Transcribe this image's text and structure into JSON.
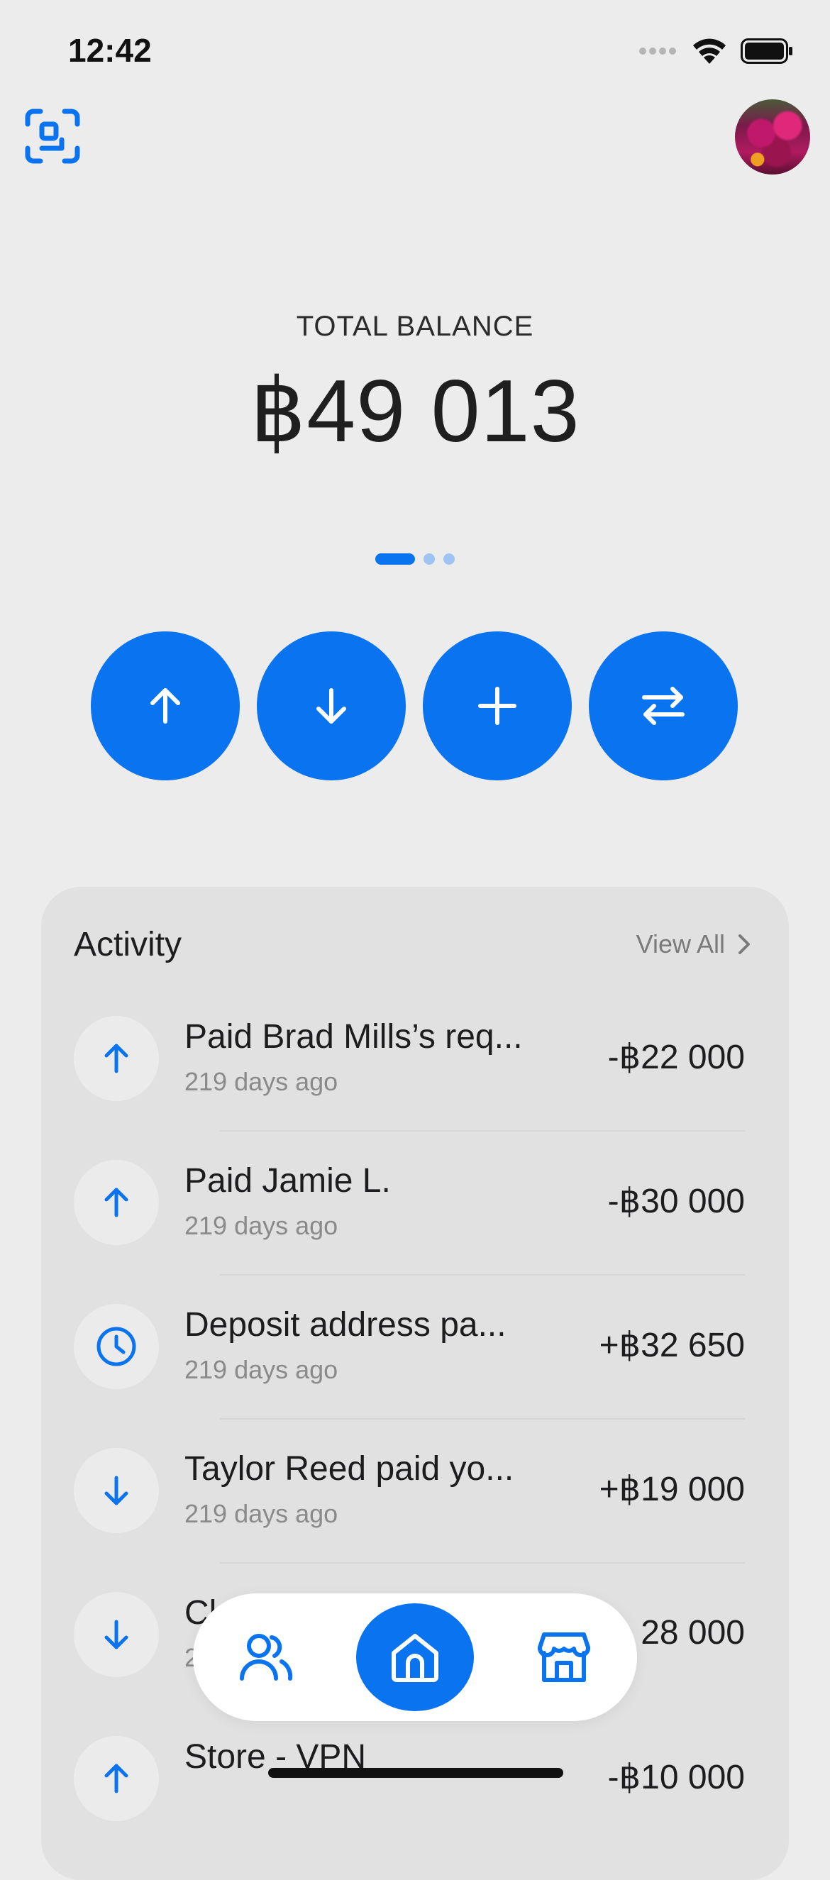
{
  "status_bar": {
    "time": "12:42"
  },
  "balance": {
    "label": "TOTAL BALANCE",
    "amount": "฿49 013"
  },
  "activity": {
    "title": "Activity",
    "view_all": "View All",
    "transactions": [
      {
        "icon": "arrow-up-icon",
        "title": "Paid Brad Mills’s req...",
        "subtitle": "219 days ago",
        "amount": "-฿22 000"
      },
      {
        "icon": "arrow-up-icon",
        "title": "Paid Jamie L.",
        "subtitle": "219 days ago",
        "amount": "-฿30 000"
      },
      {
        "icon": "clock-icon",
        "title": "Deposit address pa...",
        "subtitle": "219 days ago",
        "amount": "+฿32 650"
      },
      {
        "icon": "arrow-down-icon",
        "title": "Taylor Reed paid yo...",
        "subtitle": "219 days ago",
        "amount": "+฿19 000"
      },
      {
        "icon": "arrow-down-icon",
        "title": "Cl",
        "subtitle": "2",
        "amount": "28 000"
      },
      {
        "icon": "arrow-up-icon",
        "title": "Store - VPN",
        "subtitle": "",
        "amount": "-฿10 000"
      }
    ]
  },
  "colors": {
    "accent": "#0a74f0",
    "background": "#ececec",
    "card": "#e1e1e1"
  }
}
